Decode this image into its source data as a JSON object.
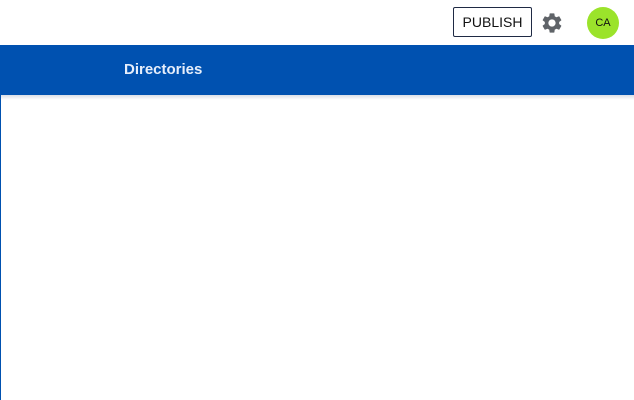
{
  "header": {
    "publish_label": "PUBLISH",
    "settings_icon": "gear-icon",
    "avatar_initials": "CA",
    "avatar_color": "#9be32b"
  },
  "nav": {
    "items": [
      {
        "label": "Directories"
      }
    ],
    "background_color": "#0051b0"
  }
}
